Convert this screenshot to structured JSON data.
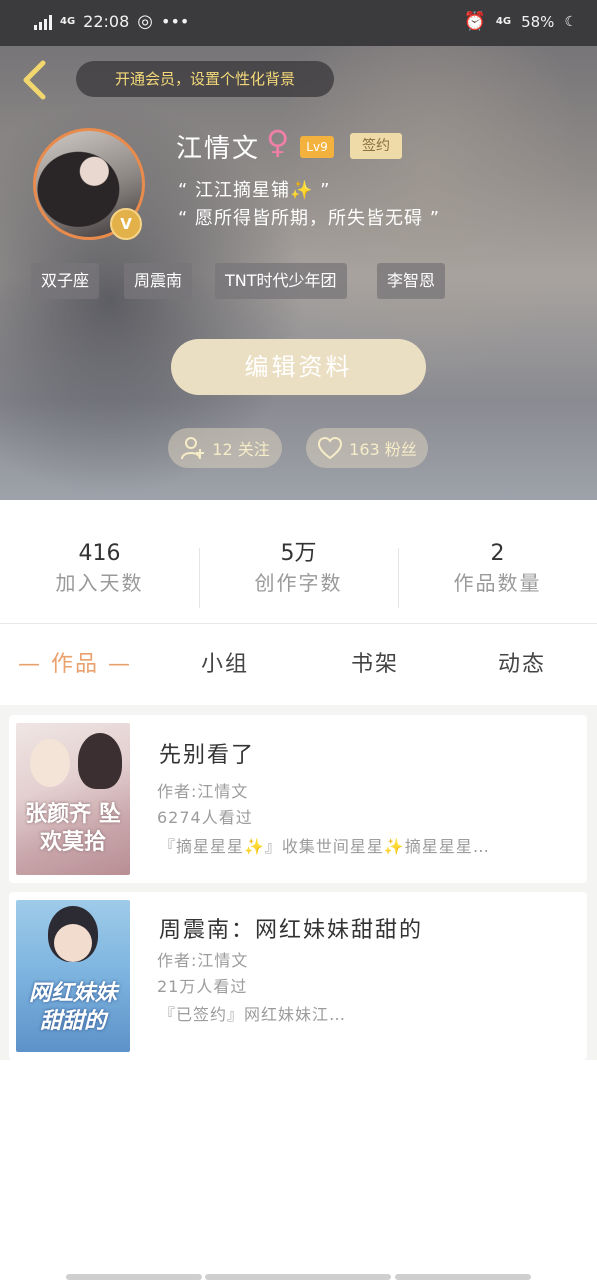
{
  "status_bar": {
    "network_left": "4G",
    "time": "22:08",
    "network_right": "4G",
    "battery": "58%"
  },
  "header": {
    "vip_prompt": "开通会员，设置个性化背景"
  },
  "profile": {
    "name": "江情文",
    "gender_symbol": "♀",
    "level": "Lv9",
    "signed_badge": "签约",
    "verified_badge": "V",
    "bio_line1": "“ 江江摘星铺✨ ”",
    "bio_line2": "“ 愿所得皆所期，所失皆无碍 ”",
    "tags": [
      "双子座",
      "周震南",
      "TNT时代少年团",
      "李智恩"
    ],
    "edit_button": "编辑资料",
    "following": "12 关注",
    "followers": "163 粉丝"
  },
  "stats": [
    {
      "value": "416",
      "label": "加入天数"
    },
    {
      "value": "5万",
      "label": "创作字数"
    },
    {
      "value": "2",
      "label": "作品数量"
    }
  ],
  "tabs": [
    "— 作品 —",
    "小组",
    "书架",
    "动态"
  ],
  "works": [
    {
      "title": "先别看了",
      "author": "作者:江情文",
      "views": "6274人看过",
      "desc": "『摘星星星✨』收集世间星星✨摘星星星…",
      "cover_text": "张颜齐 坠欢莫拾"
    },
    {
      "title": "周震南：网红妹妹甜甜的",
      "author": "作者:江情文",
      "views": "21万人看过",
      "desc": "『已签约』网红妹妹江…",
      "cover_text": "网红妹妹 甜甜的"
    }
  ],
  "colors": {
    "accent_orange": "#e9a16d",
    "vip_text": "#f3d979",
    "level_badge": "#f3b13e",
    "signed_badge": "#efdba8",
    "edit_button": "#ebdfc3"
  }
}
